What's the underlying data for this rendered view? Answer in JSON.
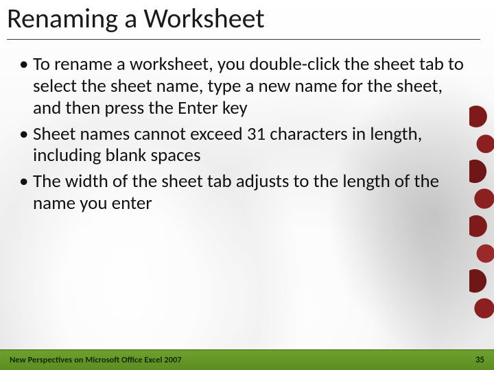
{
  "title": "Renaming a Worksheet",
  "bullets": [
    "To rename a worksheet, you double-click the sheet tab to select the sheet name, type a new name for the sheet, and then press the Enter key",
    "Sheet names cannot exceed 31 characters in length, including blank spaces",
    "The width of the sheet tab adjusts to the length of the name you enter"
  ],
  "footer": {
    "source": "New Perspectives on Microsoft Office Excel 2007",
    "page": "35"
  }
}
